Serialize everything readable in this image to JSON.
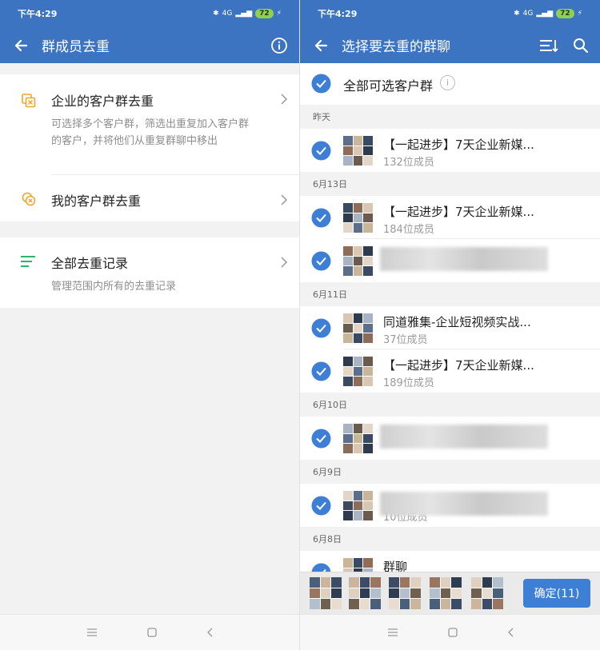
{
  "status": {
    "time": "下午4:29",
    "network": "4G",
    "battery": "72"
  },
  "left": {
    "title": "群成员去重",
    "items": [
      {
        "title": "企业的客户群去重",
        "desc": "可选择多个客户群，筛选出重复加入客户群的客户，并将他们从重复群聊中移出"
      },
      {
        "title": "我的客户群去重"
      },
      {
        "title": "全部去重记录",
        "desc": "管理范围内所有的去重记录"
      }
    ],
    "colors": {
      "accent": "#3d74c1",
      "orange": "#f0a42e",
      "green": "#2fb36b"
    }
  },
  "right": {
    "title": "选择要去重的群聊",
    "select_all": "全部可选客户群",
    "info_glyph": "i",
    "sections": [
      {
        "date": "昨天",
        "rows": [
          {
            "name": "【一起进步】7天企业新媒...",
            "count": "132位成员"
          }
        ]
      },
      {
        "date": "6月13日",
        "rows": [
          {
            "name": "【一起进步】7天企业新媒...",
            "count": "184位成员"
          },
          {
            "name": "",
            "count": ""
          }
        ]
      },
      {
        "date": "6月11日",
        "rows": [
          {
            "name": "同道雅集-企业短视频实战...",
            "count": "37位成员"
          },
          {
            "name": "【一起进步】7天企业新媒...",
            "count": "189位成员"
          }
        ]
      },
      {
        "date": "6月10日",
        "rows": [
          {
            "name": "",
            "count": ""
          }
        ]
      },
      {
        "date": "6月9日",
        "rows": [
          {
            "name": "",
            "count": "10位成员"
          }
        ]
      },
      {
        "date": "6月8日",
        "rows": [
          {
            "name": "群聊",
            "count": ""
          }
        ]
      }
    ],
    "confirm_label": "确定(11)"
  }
}
